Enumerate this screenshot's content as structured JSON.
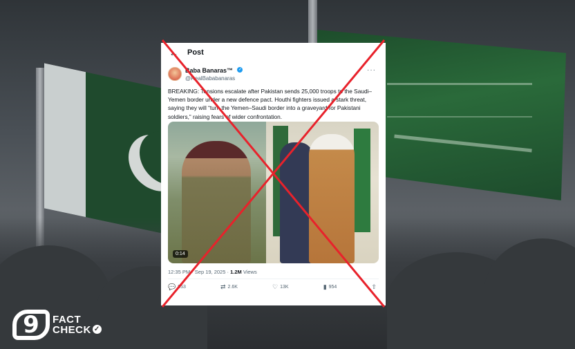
{
  "tweet": {
    "header_title": "Post",
    "back_icon": "back-arrow-icon",
    "author": {
      "display_name": "Baba Banaras™",
      "handle": "@RealBababanaras",
      "verified": true
    },
    "more_icon": "more-options-icon",
    "text": "BREAKING: Tensions escalate after Pakistan sends 25,000 troops to the Saudi–Yemen border under a new defence pact. Houthi fighters issued a stark threat, saying they will “turn the Yemen–Saudi border into a graveyard for Pakistani soldiers,” raising fears of wider confrontation.",
    "media": {
      "video_duration": "0:14"
    },
    "meta": {
      "time_date": "12:35 PM · Sep 19, 2025 · ",
      "views_count": "1.2M",
      "views_label": " Views"
    },
    "actions": {
      "replies": "953",
      "reposts": "2.6K",
      "likes": "13K",
      "bookmarks": "954"
    }
  },
  "overlay": {
    "cross_color": "#e8222b",
    "verdict": "crossed-out"
  },
  "logo": {
    "mark": "9",
    "line1": "FACT",
    "line2": "CHECK"
  }
}
